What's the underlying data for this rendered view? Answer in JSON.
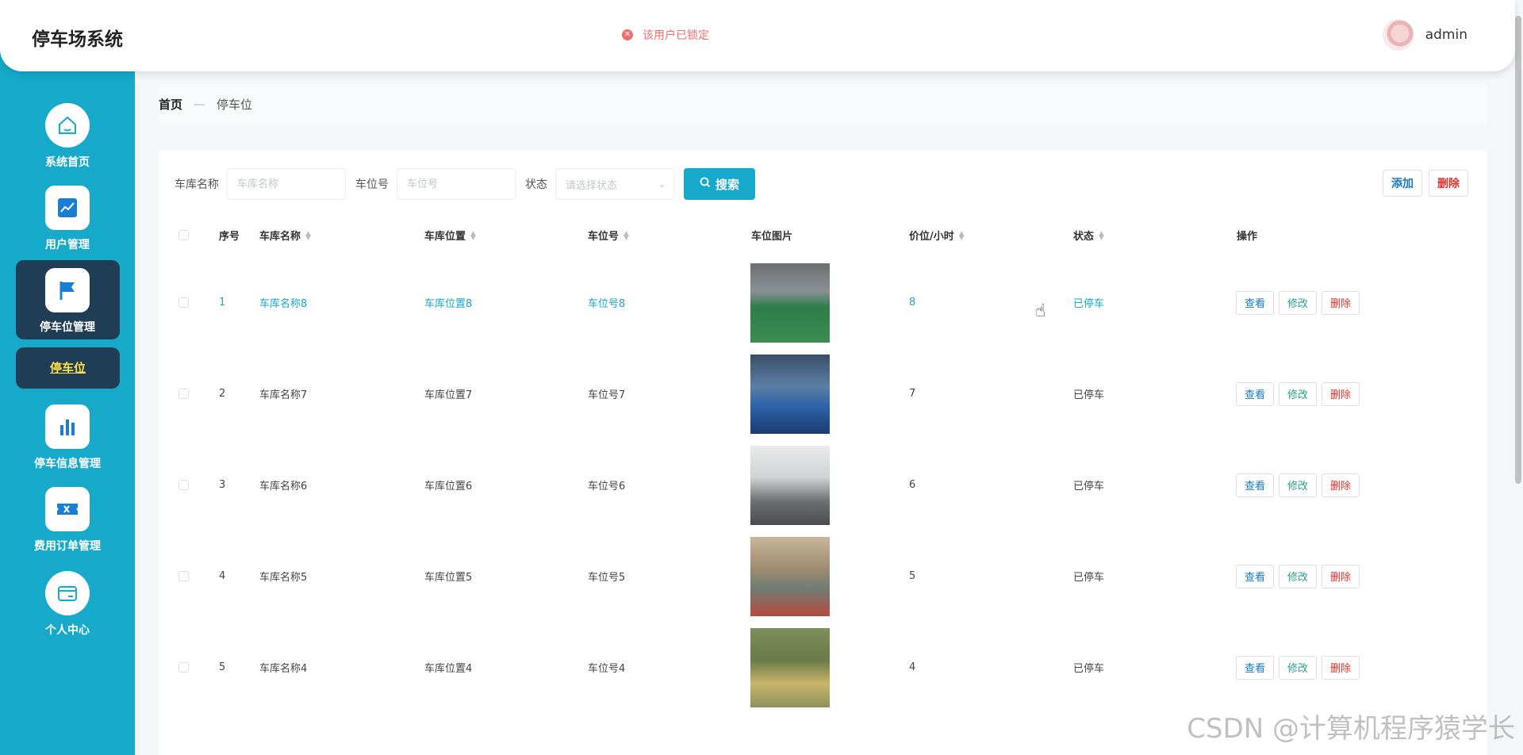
{
  "app": {
    "title": "停车场系统"
  },
  "toast": {
    "message": "该用户已锁定"
  },
  "user": {
    "name": "admin"
  },
  "sidebar": {
    "items": [
      {
        "label": "系统首页",
        "icon": "home-icon"
      },
      {
        "label": "用户管理",
        "icon": "chart-icon"
      },
      {
        "label": "停车位管理",
        "icon": "flag-icon"
      },
      {
        "label": "停车信息管理",
        "icon": "bar-chart-icon"
      },
      {
        "label": "费用订单管理",
        "icon": "ticket-icon"
      },
      {
        "label": "个人中心",
        "icon": "card-icon"
      }
    ],
    "sub_active": "停车位"
  },
  "breadcrumb": {
    "home": "首页",
    "separator": "—",
    "current": "停车位"
  },
  "search": {
    "garage_label": "车库名称",
    "garage_placeholder": "车库名称",
    "slot_label": "车位号",
    "slot_placeholder": "车位号",
    "status_label": "状态",
    "status_placeholder": "请选择状态",
    "button": "搜索"
  },
  "actions": {
    "add": "添加",
    "delete": "删除"
  },
  "table": {
    "headers": {
      "index": "序号",
      "garage": "车库名称",
      "location": "车库位置",
      "slot": "车位号",
      "image": "车位图片",
      "price": "价位/小时",
      "status": "状态",
      "ops": "操作"
    },
    "op_labels": {
      "view": "查看",
      "edit": "修改",
      "delete": "删除"
    },
    "rows": [
      {
        "index": "1",
        "garage": "车库名称8",
        "location": "车库位置8",
        "slot": "车位号8",
        "price": "8",
        "status": "已停车"
      },
      {
        "index": "2",
        "garage": "车库名称7",
        "location": "车库位置7",
        "slot": "车位号7",
        "price": "7",
        "status": "已停车"
      },
      {
        "index": "3",
        "garage": "车库名称6",
        "location": "车库位置6",
        "slot": "车位号6",
        "price": "6",
        "status": "已停车"
      },
      {
        "index": "4",
        "garage": "车库名称5",
        "location": "车库位置5",
        "slot": "车位号5",
        "price": "5",
        "status": "已停车"
      },
      {
        "index": "5",
        "garage": "车库名称4",
        "location": "车库位置4",
        "slot": "车位号4",
        "price": "4",
        "status": "已停车"
      }
    ]
  },
  "watermark": "CSDN @计算机程序猿学长",
  "colors": {
    "primary": "#16a9c9",
    "sidebar_active": "#1f3d55",
    "danger": "#e0342f",
    "link": "#1677c9",
    "success": "#2aa18c"
  }
}
